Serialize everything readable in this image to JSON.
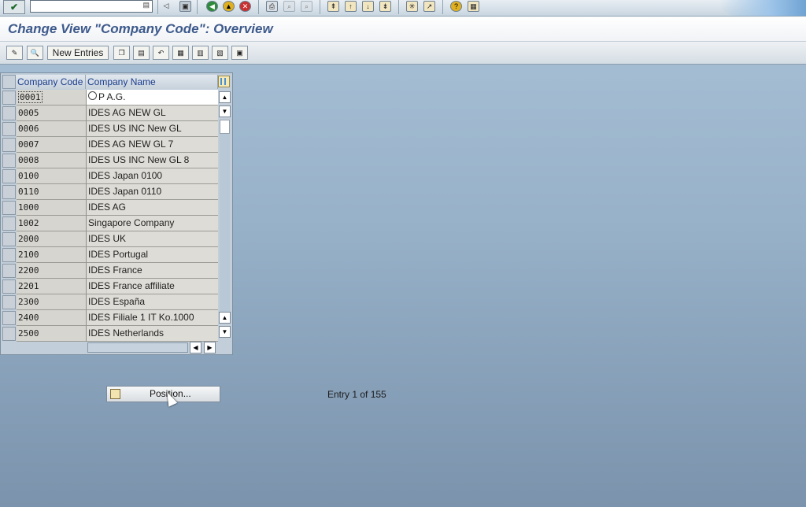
{
  "title": "Change View \"Company Code\": Overview",
  "toolbar": {
    "new_entries_label": "New Entries"
  },
  "table": {
    "columns": [
      "Company Code",
      "Company Name"
    ],
    "rows": [
      {
        "code": "0001",
        "name": "P A.G."
      },
      {
        "code": "0005",
        "name": "IDES AG NEW GL"
      },
      {
        "code": "0006",
        "name": "IDES US INC New GL"
      },
      {
        "code": "0007",
        "name": "IDES AG NEW GL 7"
      },
      {
        "code": "0008",
        "name": "IDES US INC New GL 8"
      },
      {
        "code": "0100",
        "name": "IDES Japan 0100"
      },
      {
        "code": "0110",
        "name": "IDES Japan 0110"
      },
      {
        "code": "1000",
        "name": "IDES AG"
      },
      {
        "code": "1002",
        "name": "Singapore Company"
      },
      {
        "code": "2000",
        "name": "IDES UK"
      },
      {
        "code": "2100",
        "name": "IDES Portugal"
      },
      {
        "code": "2200",
        "name": "IDES France"
      },
      {
        "code": "2201",
        "name": "IDES France affiliate"
      },
      {
        "code": "2300",
        "name": "IDES España"
      },
      {
        "code": "2400",
        "name": "IDES Filiale 1 IT Ko.1000"
      },
      {
        "code": "2500",
        "name": "IDES Netherlands"
      }
    ]
  },
  "position_button_label": "Position...",
  "entry_info": "Entry 1 of 155",
  "icons": {
    "enter": "checkmark-icon",
    "save": "save-icon",
    "back": "back-icon",
    "exit": "exit-icon",
    "cancel": "cancel-icon",
    "print": "print-icon",
    "find": "find-icon",
    "help": "help-icon",
    "layout": "layout-icon"
  }
}
